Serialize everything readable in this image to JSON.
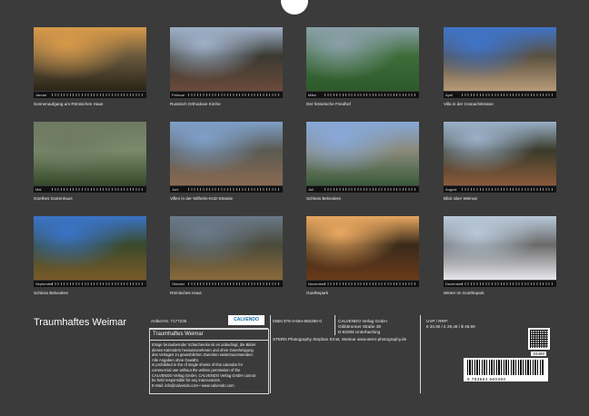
{
  "photos": [
    {
      "caption": "Sonnenaufgang am Römischen Haus",
      "month": "Januar",
      "colors": [
        "#d89a4a",
        "#2a2418",
        "#6a5a3e"
      ]
    },
    {
      "caption": "Russisch Orthodoxe Kirche",
      "month": "Februar",
      "colors": [
        "#9fb0c8",
        "#6b4a3a",
        "#3a3a32"
      ]
    },
    {
      "caption": "Der historische Friedhof",
      "month": "März",
      "colors": [
        "#8aa0a8",
        "#2e5a2a",
        "#3d6d3a"
      ]
    },
    {
      "caption": "Villa in der Cranachstrasse",
      "month": "April",
      "colors": [
        "#3f74c9",
        "#b89a78",
        "#5a5040"
      ]
    },
    {
      "caption": "Goethes Gartenhaus",
      "month": "Mai",
      "colors": [
        "#6e7a62",
        "#35492a",
        "#7a8a6a"
      ]
    },
    {
      "caption": "Villen in der Wilhelm-Külz-Strasse",
      "month": "Juni",
      "colors": [
        "#7f9fc8",
        "#8a6a52",
        "#5a5a52"
      ]
    },
    {
      "caption": "Schloss Belvedere",
      "month": "Juli",
      "colors": [
        "#88a8d8",
        "#3a5a3a",
        "#8a8a7a"
      ]
    },
    {
      "caption": "Blick über Weimar",
      "month": "August",
      "colors": [
        "#9ab0c8",
        "#8a5a3a",
        "#3a3a2a"
      ]
    },
    {
      "caption": "Schloss Belvedere",
      "month": "September",
      "colors": [
        "#3a74c8",
        "#7a5a2a",
        "#3a4a2a"
      ]
    },
    {
      "caption": "Römisches Haus",
      "month": "Oktober",
      "colors": [
        "#6a7a8a",
        "#8a6a3a",
        "#4a4a3a"
      ]
    },
    {
      "caption": "Goethepark",
      "month": "November",
      "colors": [
        "#e8a860",
        "#6a3a1a",
        "#3a2a1a"
      ]
    },
    {
      "caption": "Winter im Goethepark",
      "month": "Dezember",
      "colors": [
        "#b8c8d8",
        "#e8e8ee",
        "#6a6a6a"
      ]
    }
  ],
  "title": "Traumhaftes Weimar",
  "info": {
    "article": "Artikel-Nr. 7177235",
    "logo_text": "CALVENDO",
    "subtitle": "Traumhaftes Weimar",
    "description": [
      "Einige bezaubernder Schachrecke ist es unbedingt, die Bilder",
      "dieses Kalenders herauszunehmen und ohne Genehmigung",
      "des Verlages zu gewerblichen Zwecken weiterzuverwenden.",
      "Alle Angaben ohne Gewähr.",
      "Is prohibited in the of single sheets of this calendar for",
      "commercial use without the written permission of the",
      "CALVENDO Verlag GmbH, CALVENDO Verlag GmbH cannot",
      "be held responsible for any inaccuracies.",
      "E-Mail: info@calvendo.com • www.calvendo.com"
    ],
    "isbn": "ISBN 978-3-664-660360-0",
    "publisher": [
      "CALVENDO Verlag GmbH",
      "Gibbbrunner Straße 38",
      "D-82008 Unterhaching"
    ],
    "photographer": "STERN Photography Stephan Ernst, Weimar www.stern-photography.de",
    "price_label": "UVP / RRP:",
    "price": "€ 34,90 / £ 29,49 / $ 48,99",
    "barcode_number": "9 783664 660360",
    "barcode_code": "03490"
  }
}
